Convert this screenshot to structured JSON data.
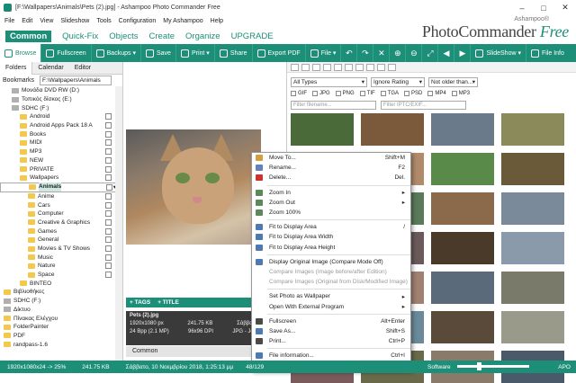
{
  "app": {
    "title": "[F:\\Wallpapers\\Animals\\Pets (2).jpg] - Ashampoo Photo Commander Free",
    "brand_top": "Ashampoo®",
    "brand_main": "PhotoCommander",
    "brand_free": "Free"
  },
  "menu": [
    "File",
    "Edit",
    "View",
    "Slideshow",
    "Tools",
    "Configuration",
    "My Ashampoo",
    "Help"
  ],
  "ribbon_tabs": [
    "Common",
    "Quick-Fix",
    "Objects",
    "Create",
    "Organize",
    "UPGRADE"
  ],
  "toolbar": {
    "browse": "Browse",
    "fullscreen": "Fullscreen",
    "backups": "Backups",
    "save": "Save",
    "print": "Print",
    "share": "Share",
    "export_pdf": "Export PDF",
    "file": "File",
    "slideshow": "SlideShow",
    "file_info": "File Info"
  },
  "left_panel": {
    "tabs": [
      "Folders",
      "Calendar",
      "Editor"
    ],
    "bookmarks_label": "Bookmarks",
    "path": "F:\\Wallpapers\\Animals",
    "tree": [
      {
        "label": "Μονάδα DVD RW (D:)",
        "type": "drive",
        "indent": 1
      },
      {
        "label": "Τοπικός δίσκος (E:)",
        "type": "drive",
        "indent": 1
      },
      {
        "label": "SDHC (F:)",
        "type": "drive",
        "indent": 1
      },
      {
        "label": "Android",
        "type": "folder",
        "indent": 2
      },
      {
        "label": "Android Apps Pack 18 A",
        "type": "folder",
        "indent": 2
      },
      {
        "label": "Books",
        "type": "folder",
        "indent": 2
      },
      {
        "label": "MIDI",
        "type": "folder",
        "indent": 2
      },
      {
        "label": "MP3",
        "type": "folder",
        "indent": 2
      },
      {
        "label": "NEW",
        "type": "folder",
        "indent": 2
      },
      {
        "label": "PRIVATE",
        "type": "folder",
        "indent": 2
      },
      {
        "label": "Wallpapers",
        "type": "folder",
        "indent": 2
      },
      {
        "label": "Animals",
        "type": "folder",
        "indent": 3,
        "selected": true
      },
      {
        "label": "Anime",
        "type": "folder",
        "indent": 3
      },
      {
        "label": "Cars",
        "type": "folder",
        "indent": 3
      },
      {
        "label": "Computer",
        "type": "folder",
        "indent": 3
      },
      {
        "label": "Creative & Graphics",
        "type": "folder",
        "indent": 3
      },
      {
        "label": "Games",
        "type": "folder",
        "indent": 3
      },
      {
        "label": "General",
        "type": "folder",
        "indent": 3
      },
      {
        "label": "Movies & TV Shows",
        "type": "folder",
        "indent": 3
      },
      {
        "label": "Music",
        "type": "folder",
        "indent": 3
      },
      {
        "label": "Nature",
        "type": "folder",
        "indent": 3
      },
      {
        "label": "Space",
        "type": "folder",
        "indent": 3
      },
      {
        "label": "BINTEO",
        "type": "folder",
        "indent": 2
      },
      {
        "label": "Βιβλιοθήκες",
        "type": "folder",
        "indent": 0
      },
      {
        "label": "SDHC (F:)",
        "type": "drive",
        "indent": 0
      },
      {
        "label": "Δίκτυο",
        "type": "drive",
        "indent": 0
      },
      {
        "label": "Πίνακας Ελέγχου",
        "type": "folder",
        "indent": 0
      },
      {
        "label": "FolderPainter",
        "type": "folder",
        "indent": 0
      },
      {
        "label": "PDF",
        "type": "folder",
        "indent": 0
      },
      {
        "label": "randpass-1.6",
        "type": "folder",
        "indent": 0
      }
    ]
  },
  "preview": {
    "tags_label": "+ TAGS",
    "title_label": "+ TITLE",
    "filename": "Pets (2).jpg",
    "dims": "1920x1080 px",
    "size": "241.75 KB",
    "date": "Σάββατο,",
    "depth": "24 Bpp (2.1 MP)",
    "dpi": "96x96 DPI",
    "fmt": "JPG - Joint",
    "common_tab": "Common"
  },
  "filters": {
    "type": "All Types",
    "rating": "Ignore Rating",
    "age": "Not older than...",
    "exts": [
      "GIF",
      "JPG",
      "PNG",
      "TIF",
      "TGA",
      "PSD",
      "MP4",
      "MP3"
    ],
    "filename_ph": "Filter filename...",
    "iptc_ph": "Filter IPTC/EXIF..."
  },
  "thumbs": [
    "#4a6a3a",
    "#7a5a3a",
    "#6a7a8a",
    "#8a8a5a",
    "#3a3a3a",
    "#b08a6a",
    "#5a8a4a",
    "#6a5a3a",
    "#2a2a2a",
    "#5a7a5a",
    "#8a6a4a",
    "#7a8a9a",
    "#9a8a7a",
    "#6a5a5a",
    "#4a3a2a",
    "#8a9aaa",
    "#c0a080",
    "#a08070",
    "#5a6a7a",
    "#7a7a6a",
    "#8a6a5a",
    "#6a8a9a",
    "#5a4a3a",
    "#9a9a8a",
    "#7a5a5a",
    "#6a6a4a",
    "#8a7a6a",
    "#4a5a6a"
  ],
  "context_menu": [
    {
      "label": "Move To...",
      "sc": "Shift+M",
      "icon": "#d0a040"
    },
    {
      "label": "Rename...",
      "sc": "F2",
      "icon": "#6080c0"
    },
    {
      "label": "Delete...",
      "sc": "Del.",
      "icon": "#d03030"
    },
    {
      "sep": true
    },
    {
      "label": "Zoom In",
      "ar": "▸",
      "icon": "#5a8a5a"
    },
    {
      "label": "Zoom Out",
      "ar": "▸",
      "icon": "#5a8a5a"
    },
    {
      "label": "Zoom 100%",
      "sc": "",
      "icon": "#5a8a5a"
    },
    {
      "sep": true
    },
    {
      "label": "Fit to Display Area",
      "sc": "/",
      "icon": "#4a7ab0"
    },
    {
      "label": "Fit to Display Area Width",
      "sc": "",
      "icon": "#4a7ab0"
    },
    {
      "label": "Fit to Display Area Height",
      "sc": "",
      "icon": "#4a7ab0"
    },
    {
      "sep": true
    },
    {
      "label": "Display Original Image (Compare Mode Off)",
      "sc": "",
      "icon": "#4a7ab0"
    },
    {
      "label": "Compare Images (Image before/after Edition)",
      "sc": "",
      "dis": true
    },
    {
      "label": "Compare Images (Original from Disk/Modified Image)",
      "sc": "",
      "dis": true
    },
    {
      "sep": true
    },
    {
      "label": "Set Photo as Wallpaper",
      "ar": "▸",
      "icon": ""
    },
    {
      "label": "Open With External Program",
      "ar": "▸",
      "icon": ""
    },
    {
      "sep": true
    },
    {
      "label": "Fullscreen",
      "sc": "Alt+Enter",
      "icon": "#4a4a4a"
    },
    {
      "label": "Save As...",
      "sc": "Shift+S",
      "icon": "#4a7ab0"
    },
    {
      "label": "Print...",
      "sc": "Ctrl+P",
      "icon": "#4a4a4a"
    },
    {
      "sep": true
    },
    {
      "label": "File information...",
      "sc": "Ctrl+I",
      "icon": "#4a7ab0"
    }
  ],
  "status": {
    "res": "1920x1080x24 -> 25%",
    "size": "241.75 KB",
    "date": "Σάββατο, 10 Νοεμβρίου 2018, 1:25:13 μμ",
    "count": "48/129",
    "software": "Software",
    "apo": "APO"
  }
}
